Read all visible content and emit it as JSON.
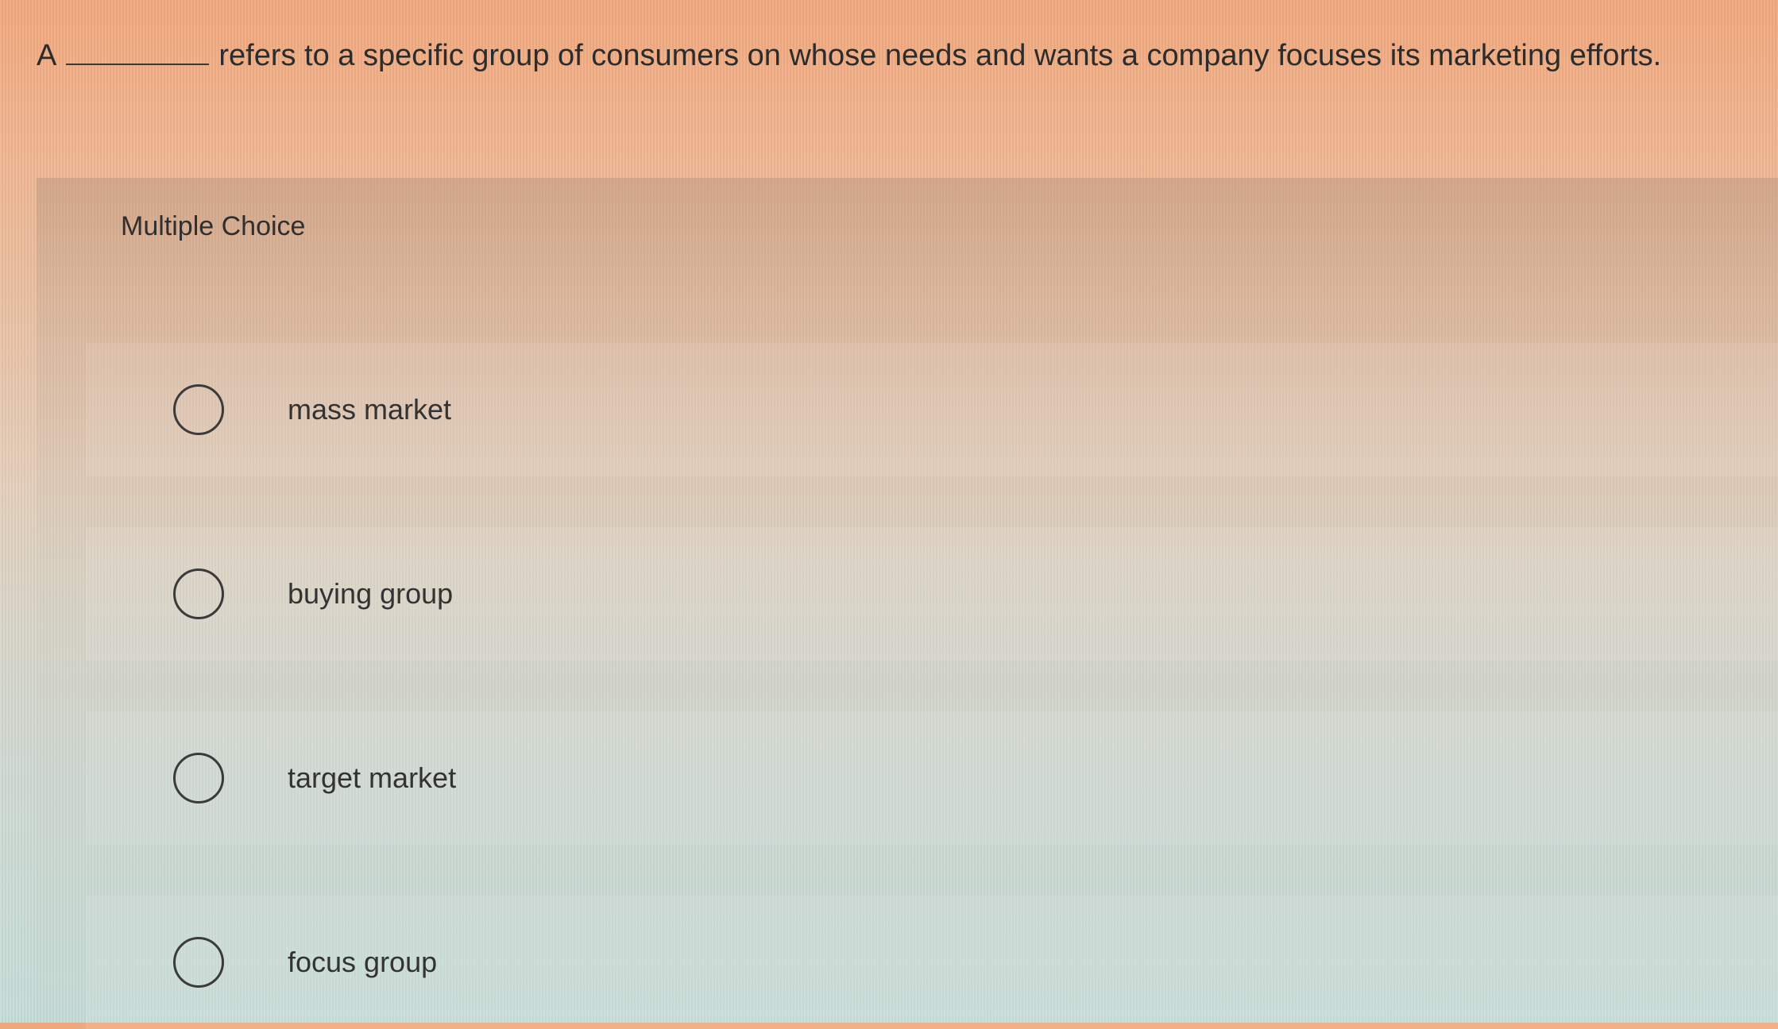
{
  "question": {
    "prefix": "A",
    "suffix": "refers to a specific group of consumers on whose needs and wants a company focuses its marketing efforts."
  },
  "panel": {
    "title": "Multiple Choice"
  },
  "options": [
    {
      "label": "mass market"
    },
    {
      "label": "buying group"
    },
    {
      "label": "target market"
    },
    {
      "label": "focus group"
    }
  ]
}
